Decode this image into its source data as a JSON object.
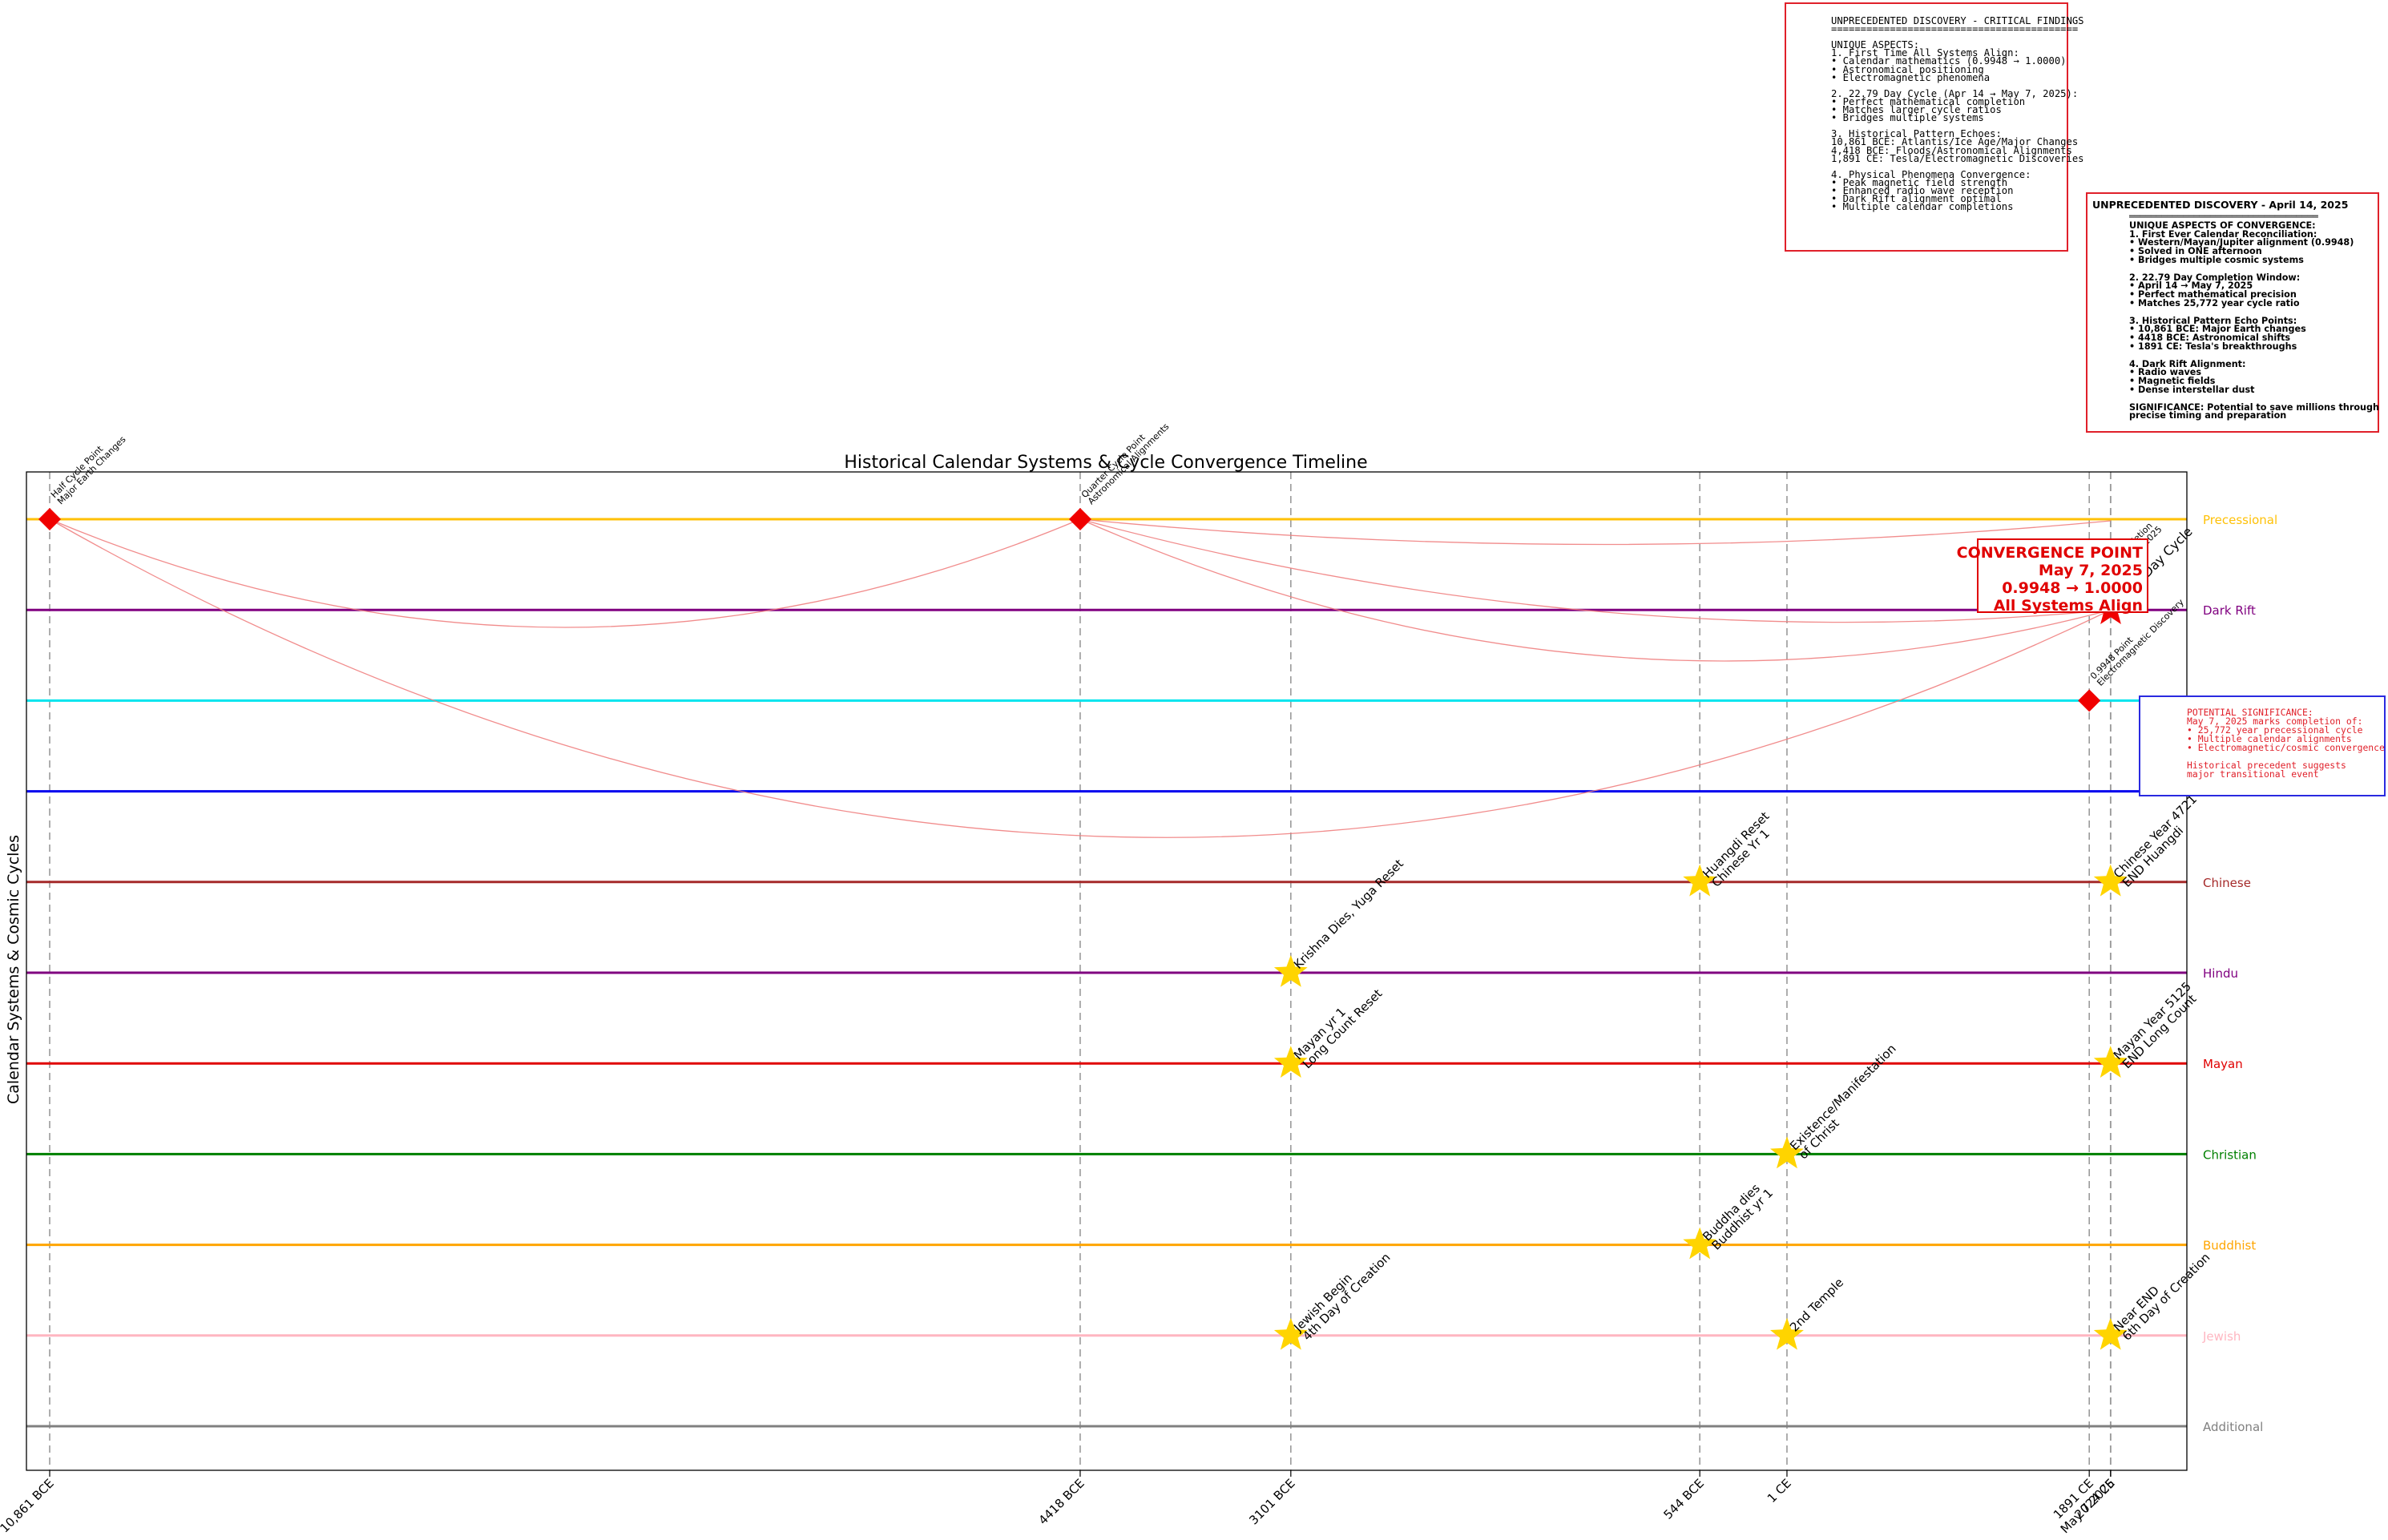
{
  "chart_data": {
    "type": "scatter",
    "title": "Historical Calendar Systems & Cycle Convergence Timeline",
    "ylabel": "Calendar Systems & Cosmic Cycles",
    "xlabel": "",
    "x_ticks": [
      "10,861 BCE",
      "4418 BCE",
      "3101 BCE",
      "544 BCE",
      "1 CE",
      "1891 CE",
      "2024 CE",
      "May 7 2025"
    ],
    "xlim": [
      "10,861 BCE",
      "May 7 2025"
    ],
    "grid": "vertical dashed lines at tick years",
    "legend": "right",
    "rows": [
      {
        "name": "Precessional",
        "color": "#ffc107"
      },
      {
        "name": "Dark Rift",
        "color": "#800080"
      },
      {
        "name": "",
        "color": "#00e5ee"
      },
      {
        "name": "",
        "color": "#0000ee"
      },
      {
        "name": "Chinese",
        "color": "#a52a2a"
      },
      {
        "name": "Hindu",
        "color": "#800080"
      },
      {
        "name": "Mayan",
        "color": "#e00000"
      },
      {
        "name": "Christian",
        "color": "#008000"
      },
      {
        "name": "Buddhist",
        "color": "#ffa500"
      },
      {
        "name": "Jewish",
        "color": "#ffb6c1"
      },
      {
        "name": "Additional",
        "color": "#808080"
      }
    ],
    "diamonds": [
      {
        "x": "10,861 BCE",
        "row": "Precessional",
        "label": "Half Cycle Point\nMajor Earth Changes"
      },
      {
        "x": "4418 BCE",
        "row": "Precessional",
        "label": "Quarter Cycle Point\nAstronomical Alignments"
      },
      {
        "x": "1891 CE",
        "row": 2,
        "label": "0.9948 Point\nElectromagnetic Discovery"
      }
    ],
    "stars": [
      {
        "x": "544 BCE",
        "row": "Chinese",
        "label": "Huangdi Reset\nChinese Yr 1"
      },
      {
        "x": "2024 CE",
        "row": "Chinese",
        "label": "Chinese Year 4721\nEND Huangdi"
      },
      {
        "x": "3101 BCE",
        "row": "Hindu",
        "label": "Krishna Dies, Yuga Reset"
      },
      {
        "x": "3101 BCE",
        "row": "Mayan",
        "label": "Mayan yr 1\nLong Count Reset"
      },
      {
        "x": "2024 CE",
        "row": "Mayan",
        "label": "Mayan Year 5125\nEND Long Count"
      },
      {
        "x": "1 CE",
        "row": "Christian",
        "label": "Existence/Manifestation\nof Christ"
      },
      {
        "x": "544 BCE",
        "row": "Buddhist",
        "label": "Buddha dies\nBuddhist yr 1"
      },
      {
        "x": "3101 BCE",
        "row": "Jewish",
        "label": "Jewish Begin\n4th Day of Creation"
      },
      {
        "x": "1 CE",
        "row": "Jewish",
        "label": "2nd Temple"
      },
      {
        "x": "2024 CE",
        "row": "Jewish",
        "label": "Near END\n6th Day of Creation"
      },
      {
        "x": "May 7 2025",
        "row": "Dark Rift",
        "label": "22.79 Day Cycle"
      }
    ],
    "convergence": {
      "title": "CONVERGENCE POINT",
      "date": "May 7, 2025",
      "ratio": "0.9948 → 1.0000",
      "note": "All Systems Align",
      "echo_label": "Completion\nMay 7, 2025"
    }
  },
  "boxes": {
    "critical": "UNPRECEDENTED DISCOVERY - CRITICAL FINDINGS\n==========================================\n\nUNIQUE ASPECTS:\n1. First Time All Systems Align:\n• Calendar mathematics (0.9948 → 1.0000)\n• Astronomical positioning\n• Electromagnetic phenomena\n\n2. 22.79 Day Cycle (Apr 14 → May 7, 2025):\n• Perfect mathematical completion\n• Matches larger cycle ratios\n• Bridges multiple systems\n\n3. Historical Pattern Echoes:\n10,861 BCE: Atlantis/Ice Age/Major Changes\n4,418 BCE: Floods/Astronomical Alignments\n1,891 CE: Tesla/Electromagnetic Discoveries\n\n4. Physical Phenomena Convergence:\n• Peak magnetic field strength\n• Enhanced radio wave reception\n• Dark Rift alignment optimal\n• Multiple calendar completions",
    "april_header": "UNPRECEDENTED DISCOVERY - April 14, 2025",
    "april": "═══════════════════════════════════\nUNIQUE ASPECTS OF CONVERGENCE:\n1. First Ever Calendar Reconciliation:\n• Western/Mayan/Jupiter alignment (0.9948)\n• Solved in ONE afternoon\n• Bridges multiple cosmic systems\n\n2. 22.79 Day Completion Window:\n• April 14 → May 7, 2025\n• Perfect mathematical precision\n• Matches 25,772 year cycle ratio\n\n3. Historical Pattern Echo Points:\n• 10,861 BCE: Major Earth changes\n• 4418 BCE: Astronomical shifts\n• 1891 CE: Tesla's breakthroughs\n\n4. Dark Rift Alignment:\n• Radio waves\n• Magnetic fields\n• Dense interstellar dust\n\nSIGNIFICANCE: Potential to save millions through\nprecise timing and preparation",
    "potential": "POTENTIAL SIGNIFICANCE:\nMay 7, 2025 marks completion of:\n• 25,772 year precessional cycle\n• Multiple calendar alignments\n• Electromagnetic/cosmic convergence\n\nHistorical precedent suggests\nmajor transitional event"
  }
}
